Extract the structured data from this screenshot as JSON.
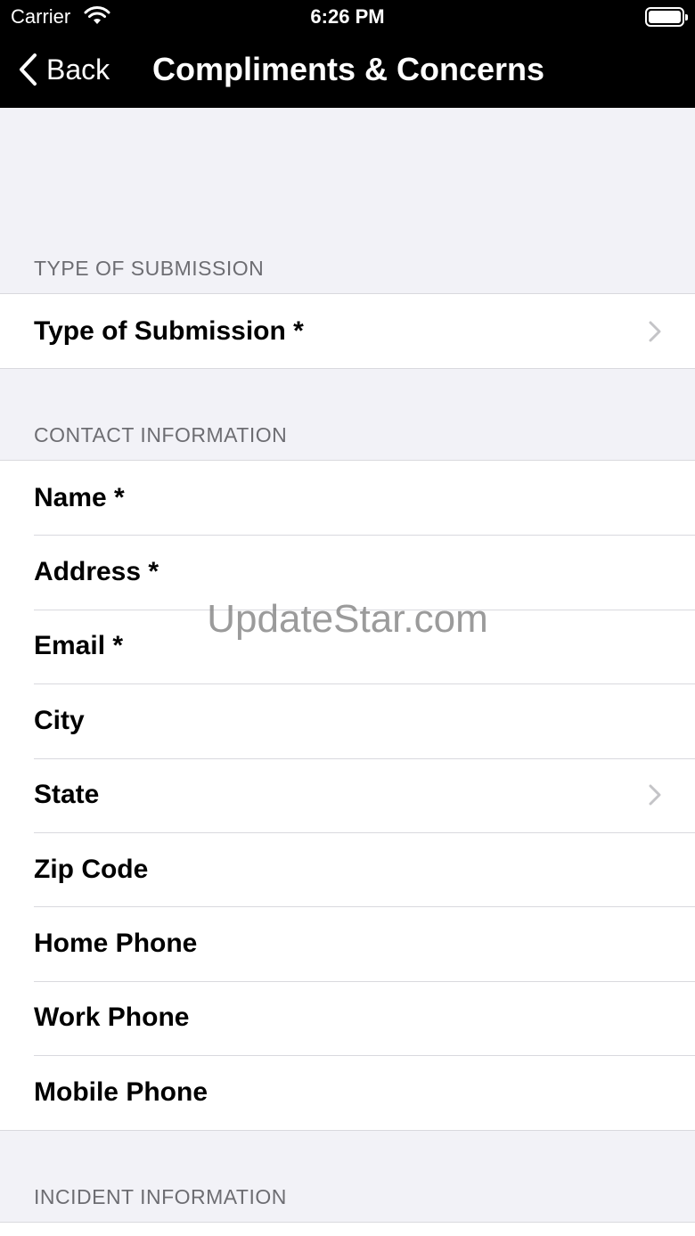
{
  "status_bar": {
    "carrier": "Carrier",
    "time": "6:26 PM"
  },
  "nav": {
    "back_label": "Back",
    "title": "Compliments & Concerns"
  },
  "sections": {
    "type": {
      "header": "TYPE OF SUBMISSION",
      "rows": [
        {
          "label": "Type of Submission *",
          "chevron": true
        }
      ]
    },
    "contact": {
      "header": "CONTACT INFORMATION",
      "rows": [
        {
          "label": "Name *"
        },
        {
          "label": "Address *"
        },
        {
          "label": "Email *"
        },
        {
          "label": "City"
        },
        {
          "label": "State",
          "chevron": true
        },
        {
          "label": "Zip Code"
        },
        {
          "label": "Home Phone"
        },
        {
          "label": "Work Phone"
        },
        {
          "label": "Mobile Phone"
        }
      ]
    },
    "incident": {
      "header": "INCIDENT INFORMATION"
    }
  },
  "watermark": "UpdateStar.com",
  "icons": {
    "back": "chevron-left-icon",
    "disclosure": "chevron-right-icon",
    "wifi": "wifi-icon",
    "battery": "battery-icon"
  },
  "colors": {
    "nav_bar": "#000000",
    "background": "#f2f2f7",
    "section_header": "#6d6d72",
    "separator": "#d9d9de",
    "chevron": "#c4c4c7"
  }
}
